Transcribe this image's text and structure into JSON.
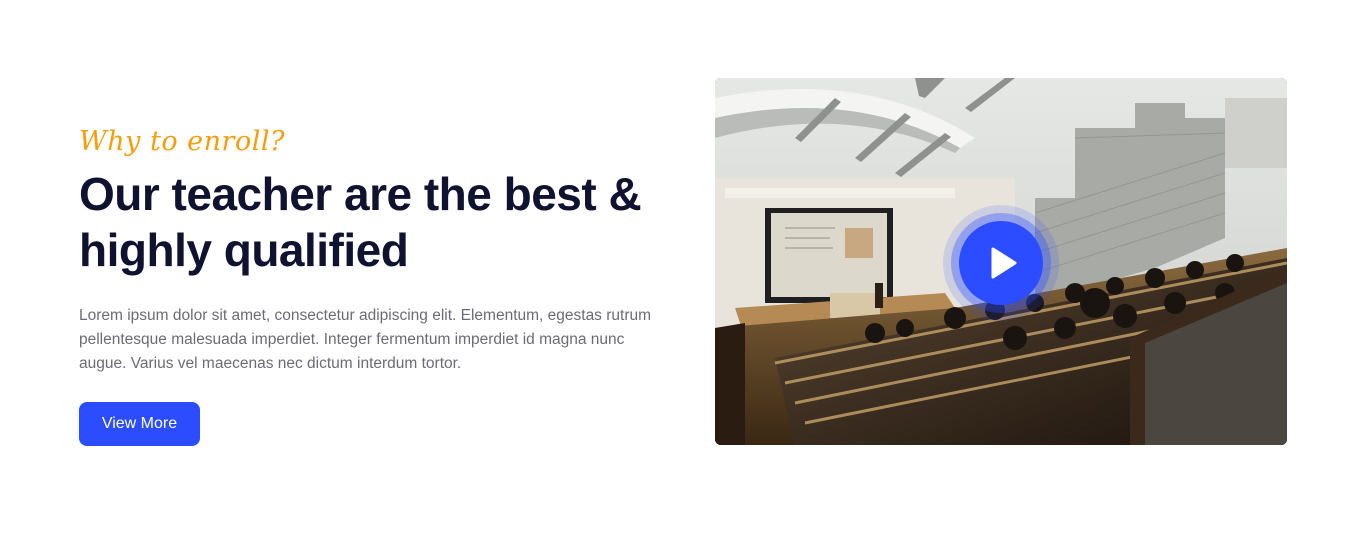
{
  "enroll": {
    "eyebrow": "Why to enroll?",
    "title_line1": "Our teacher are the best &",
    "title_line2": "highly qualified",
    "description": "Lorem ipsum dolor sit amet, consectetur adipiscing elit. Elementum, egestas rutrum pellentesque malesuada imperdiet. Integer fermentum imperdiet id magna nunc augue. Varius vel maecenas nec dictum interdum tortor.",
    "button_label": "View More"
  },
  "media": {
    "image_description_icon": "lecture-hall-photo",
    "play_icon": "play-icon"
  },
  "colors": {
    "accent": "#2b4cff",
    "eyebrow": "#f59e0b",
    "heading": "#0f1330",
    "body_text": "#6b6b75"
  }
}
